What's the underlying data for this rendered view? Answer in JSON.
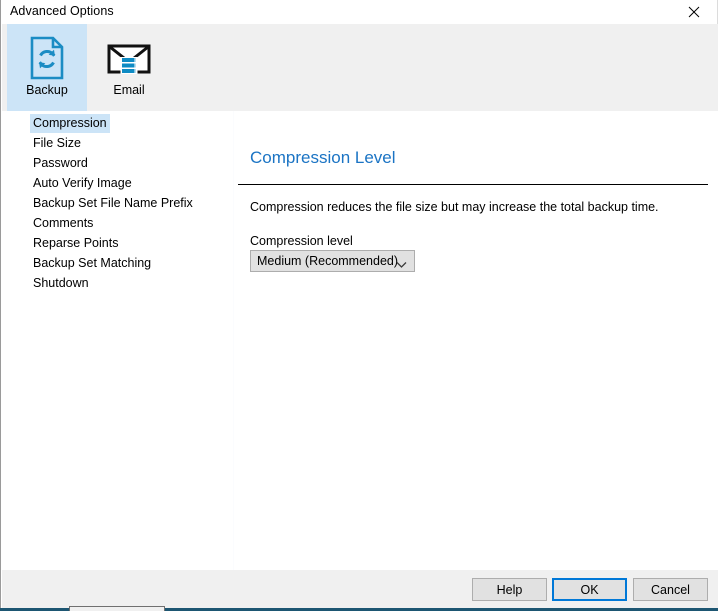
{
  "window": {
    "title": "Advanced Options",
    "close_icon": "close-icon"
  },
  "ribbon": {
    "tabs": [
      {
        "label": "Backup",
        "icon": "document-sync-icon",
        "selected": true
      },
      {
        "label": "Email",
        "icon": "envelope-server-icon",
        "selected": false
      }
    ]
  },
  "sidebar": {
    "items": [
      {
        "label": "Compression",
        "selected": true
      },
      {
        "label": "File Size",
        "selected": false
      },
      {
        "label": "Password",
        "selected": false
      },
      {
        "label": "Auto Verify Image",
        "selected": false
      },
      {
        "label": "Backup Set File Name Prefix",
        "selected": false
      },
      {
        "label": "Comments",
        "selected": false
      },
      {
        "label": "Reparse Points",
        "selected": false
      },
      {
        "label": "Backup Set Matching",
        "selected": false
      },
      {
        "label": "Shutdown",
        "selected": false
      }
    ]
  },
  "pane": {
    "title": "Compression Level",
    "description": "Compression reduces the file size but may increase the total backup time.",
    "field_label": "Compression level",
    "combo_value": "Medium (Recommended)",
    "combo_arrow_icon": "chevron-down-icon"
  },
  "footer": {
    "help_label": "Help",
    "ok_label": "OK",
    "cancel_label": "Cancel"
  },
  "colors": {
    "accent_blue": "#1b74c4",
    "selection_blue": "#cce4f7",
    "focus_border": "#0078d7",
    "icon_blue": "#1b8cc4",
    "chrome_gray": "#f0f0f0"
  }
}
